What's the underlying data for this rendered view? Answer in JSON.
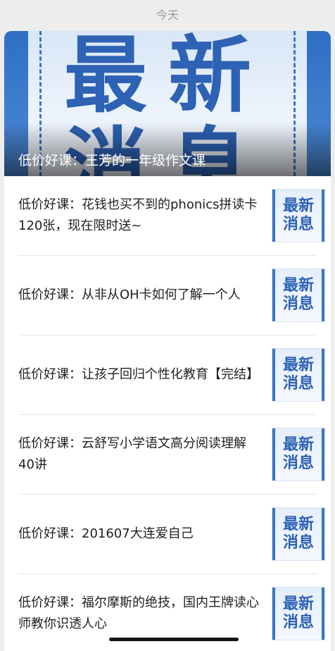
{
  "date_label": "今天",
  "cover": {
    "art_line1": "最新",
    "art_line2": "消息",
    "title": "低价好课：王芳的一年级作文课"
  },
  "thumb_text": {
    "line1": "最新",
    "line2": "消息"
  },
  "items": [
    {
      "title": "低价好课：花钱也买不到的phonics拼读卡120张，现在限时送~"
    },
    {
      "title": "低价好课：从非从OH卡如何了解一个人"
    },
    {
      "title": "低价好课：让孩子回归个性化教育【完结】"
    },
    {
      "title": "低价好课：云舒写小学语文高分阅读理解40讲"
    },
    {
      "title": "低价好课：201607大连爱自己"
    },
    {
      "title": "低价好课：福尔摩斯的绝技，国内王牌读心师教你识透人心"
    }
  ],
  "colors": {
    "accent_blue": "#2d62b4",
    "background": "#ededed",
    "card": "#ffffff"
  }
}
